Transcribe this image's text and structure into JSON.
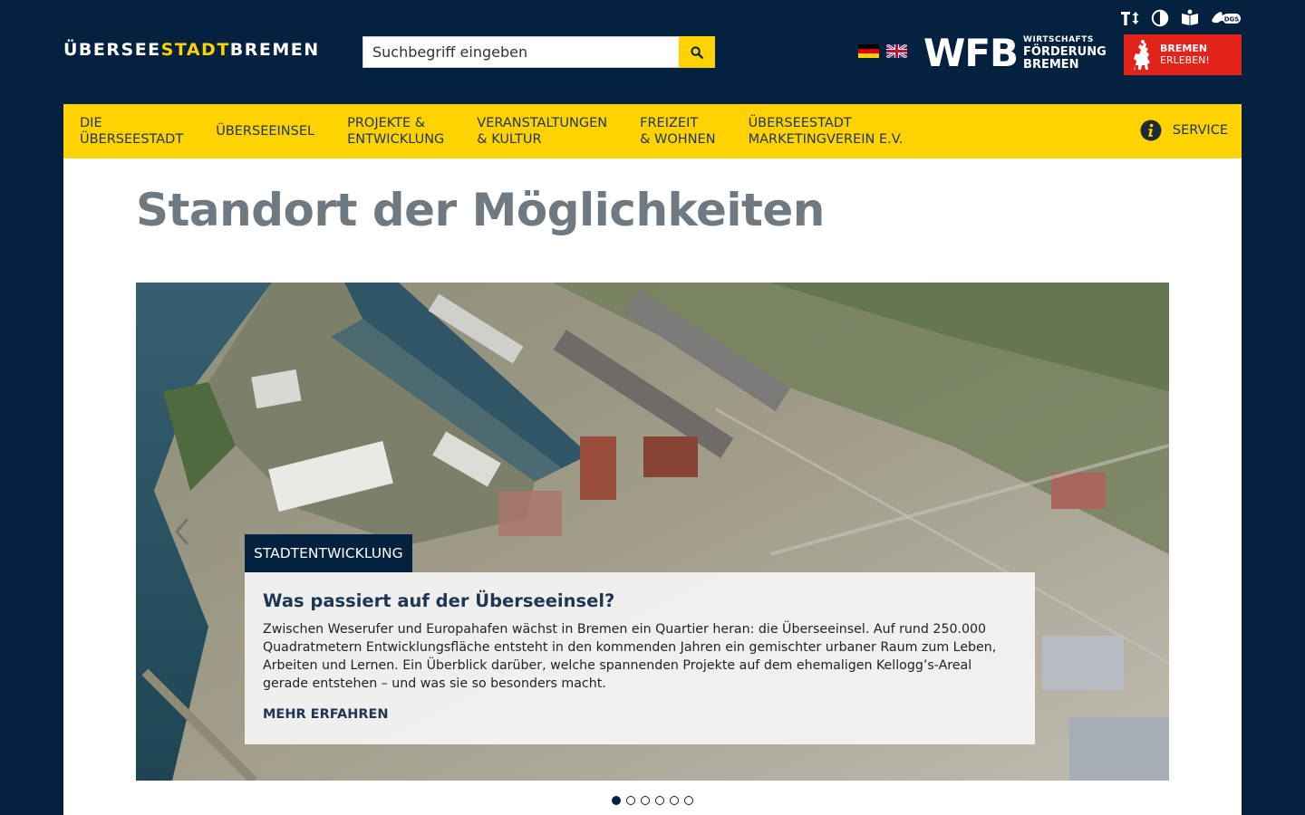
{
  "header": {
    "logo_part1": "ÜBERSEE",
    "logo_part2": "STADT",
    "logo_part3": " BREMEN",
    "search_placeholder": "Suchbegriff eingeben",
    "wfb_letters": "WFB",
    "wfb_line1": "WIRTSCHAFTS",
    "wfb_line2": "FÖRDERUNG",
    "wfb_line3": "BREMEN",
    "bremen_line1": "BREMEN",
    "bremen_line2": "ERLEBEN!",
    "a11y_icons": [
      "text-size-icon",
      "contrast-icon",
      "easy-language-icon",
      "sign-language-icon"
    ],
    "sign_language_label": "DGS",
    "flags": [
      "de",
      "en"
    ]
  },
  "nav": {
    "items": [
      "DIE\nÜBERSEESTADT",
      "ÜBERSEEINSEL",
      "PROJEKTE &\nENTWICKLUNG",
      "VERANSTALTUNGEN\n& KULTUR",
      "FREIZEIT\n& WOHNEN",
      "ÜBERSEESTADT\nMARKETINGVEREIN E.V."
    ],
    "service_label": "SERVICE"
  },
  "main": {
    "title": "Standort der Möglichkeiten",
    "slider": {
      "tag": "STADTENTWICKLUNG",
      "heading": "Was passiert auf der Überseeinsel?",
      "text": "Zwischen Weserufer und Europahafen wächst in Bremen ein Quartier heran: die Überseeinsel. Auf rund 250.000 Quadratmetern Entwicklungsfläche entsteht in den kommenden Jahren ein gemischter urbaner Raum zum Leben, Arbeiten und Lernen. Ein Überblick darüber, welche spannenden Projekte auf dem ehemaligen Kellogg’s-Areal gerade entstehen – und was sie so besonders macht.",
      "more": "MEHR ERFAHREN",
      "slide_count": 6,
      "active_slide": 1
    }
  },
  "colors": {
    "navy": "#04223f",
    "yellow": "#ffd200",
    "red": "#e2231a",
    "grey_title": "#6f7981"
  }
}
